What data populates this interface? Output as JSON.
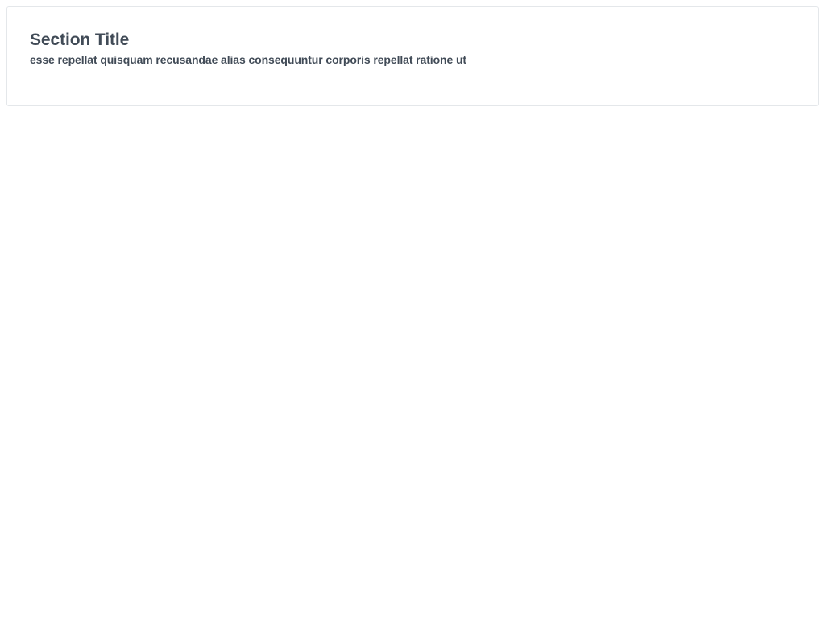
{
  "section": {
    "title": "Section Title",
    "description": "esse repellat quisquam recusandae alias consequuntur corporis repellat ratione ut"
  },
  "colors": {
    "text": "#414b57",
    "card_border": "#e4e7ea",
    "background": "#ffffff"
  }
}
